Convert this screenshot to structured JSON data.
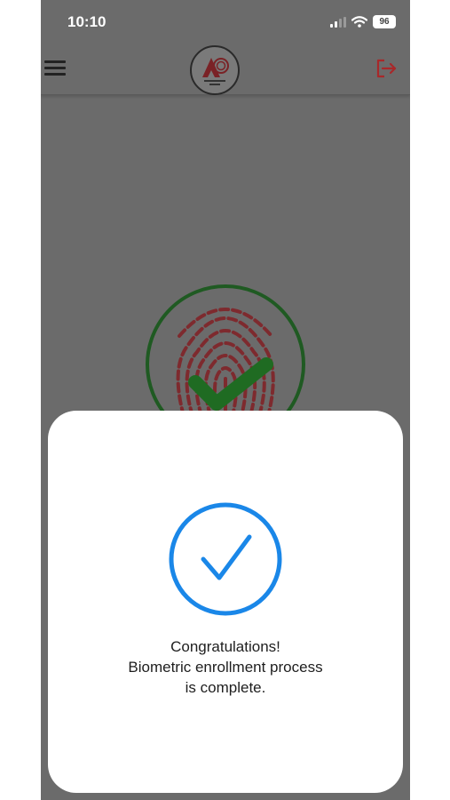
{
  "status_bar": {
    "time": "10:10",
    "battery": "96",
    "icons": [
      "signal-icon",
      "wifi-icon",
      "battery-icon"
    ]
  },
  "app_bar": {
    "menu_icon": "hamburger-menu-icon",
    "logo_icon": "organization-logo",
    "logout_icon": "logout-icon"
  },
  "background": {
    "fingerprint_icon": "fingerprint-icon",
    "check_icon": "checkmark-icon"
  },
  "dialog": {
    "icon": "success-check-circle-icon",
    "line1": "Congratulations!",
    "line2": "Biometric enrollment process",
    "line3": "is complete."
  },
  "colors": {
    "overlay": "#6b6b6b",
    "accent_blue": "#1a87e8",
    "logout_red": "#a8282a",
    "fingerprint_red": "#8a2a2e",
    "success_green": "#1f6b22"
  }
}
